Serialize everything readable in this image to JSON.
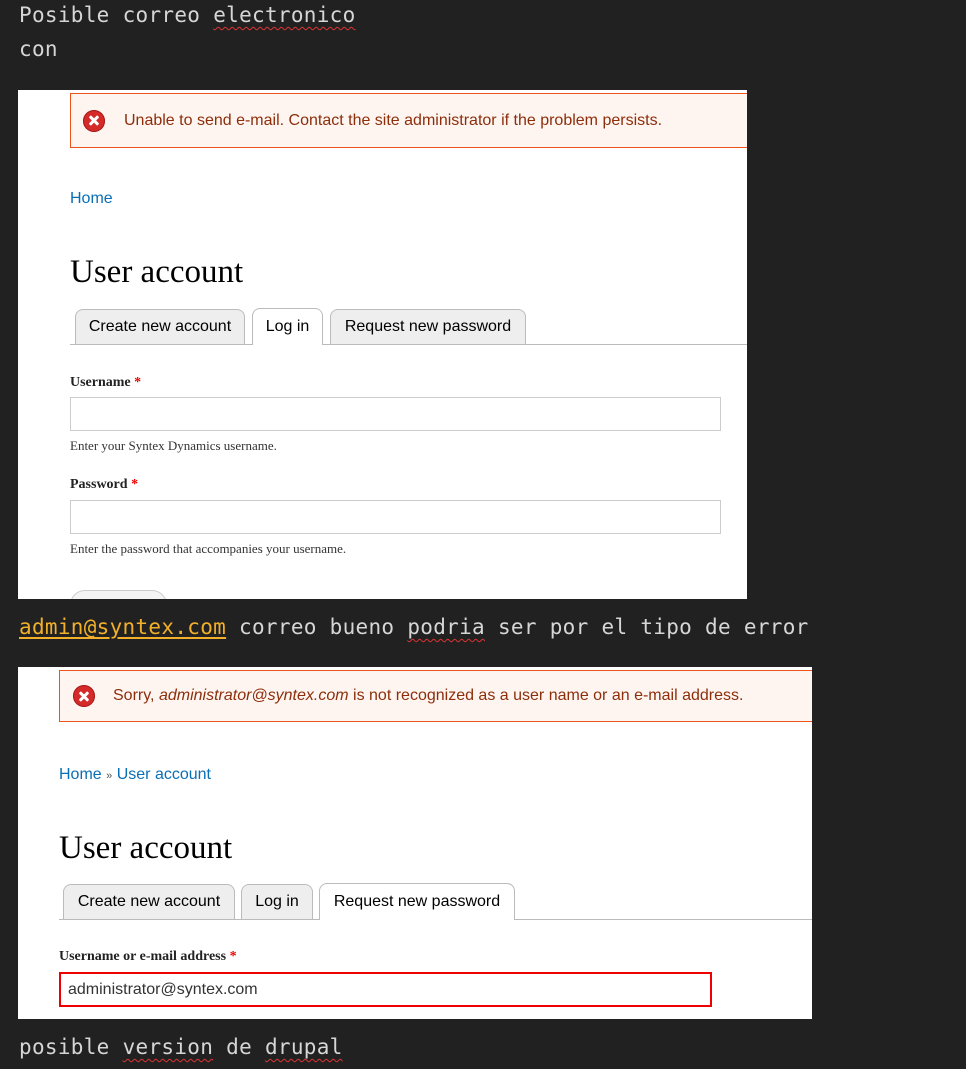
{
  "notes": {
    "line1": {
      "w1": "Posible",
      "w2": "correo",
      "w3": "electronico"
    },
    "line2": "con",
    "line3": {
      "email_link": "admin@syntex.com",
      "t1": "correo bueno",
      "t2": "podria",
      "t3": "ser por el tipo de error"
    },
    "line4": {
      "w1": "posible",
      "w2": "version",
      "w3": "de",
      "w4": "drupal"
    }
  },
  "shot1": {
    "error_message": "Unable to send e-mail. Contact the site administrator if the problem persists.",
    "breadcrumb_home": "Home",
    "title": "User account",
    "tabs": [
      "Create new account",
      "Log in",
      "Request new password"
    ],
    "active_tab": "Log in",
    "username_label": "Username",
    "username_value": "",
    "username_help": "Enter your Syntex Dynamics username.",
    "password_label": "Password",
    "password_value": "",
    "password_help": "Enter the password that accompanies your username.",
    "required_marker": "*"
  },
  "shot2": {
    "error_prefix": "Sorry, ",
    "error_email": "administrator@syntex.com",
    "error_suffix": " is not recognized as a user name or an e-mail address.",
    "breadcrumb_home": "Home",
    "breadcrumb_sep": "»",
    "breadcrumb_current": "User account",
    "title": "User account",
    "tabs": [
      "Create new account",
      "Log in",
      "Request new password"
    ],
    "active_tab": "Request new password",
    "identifier_label": "Username or e-mail address",
    "identifier_value": "administrator@syntex.com",
    "required_marker": "*"
  },
  "colors": {
    "editor_bg": "#212121",
    "editor_text": "#d6d6d6",
    "link_note": "#f2b02a",
    "error_border": "#ed541d",
    "error_bg": "#fef5f1",
    "error_text": "#8c2e0b",
    "drupal_link": "#0a6fb5",
    "required": "#e00"
  }
}
